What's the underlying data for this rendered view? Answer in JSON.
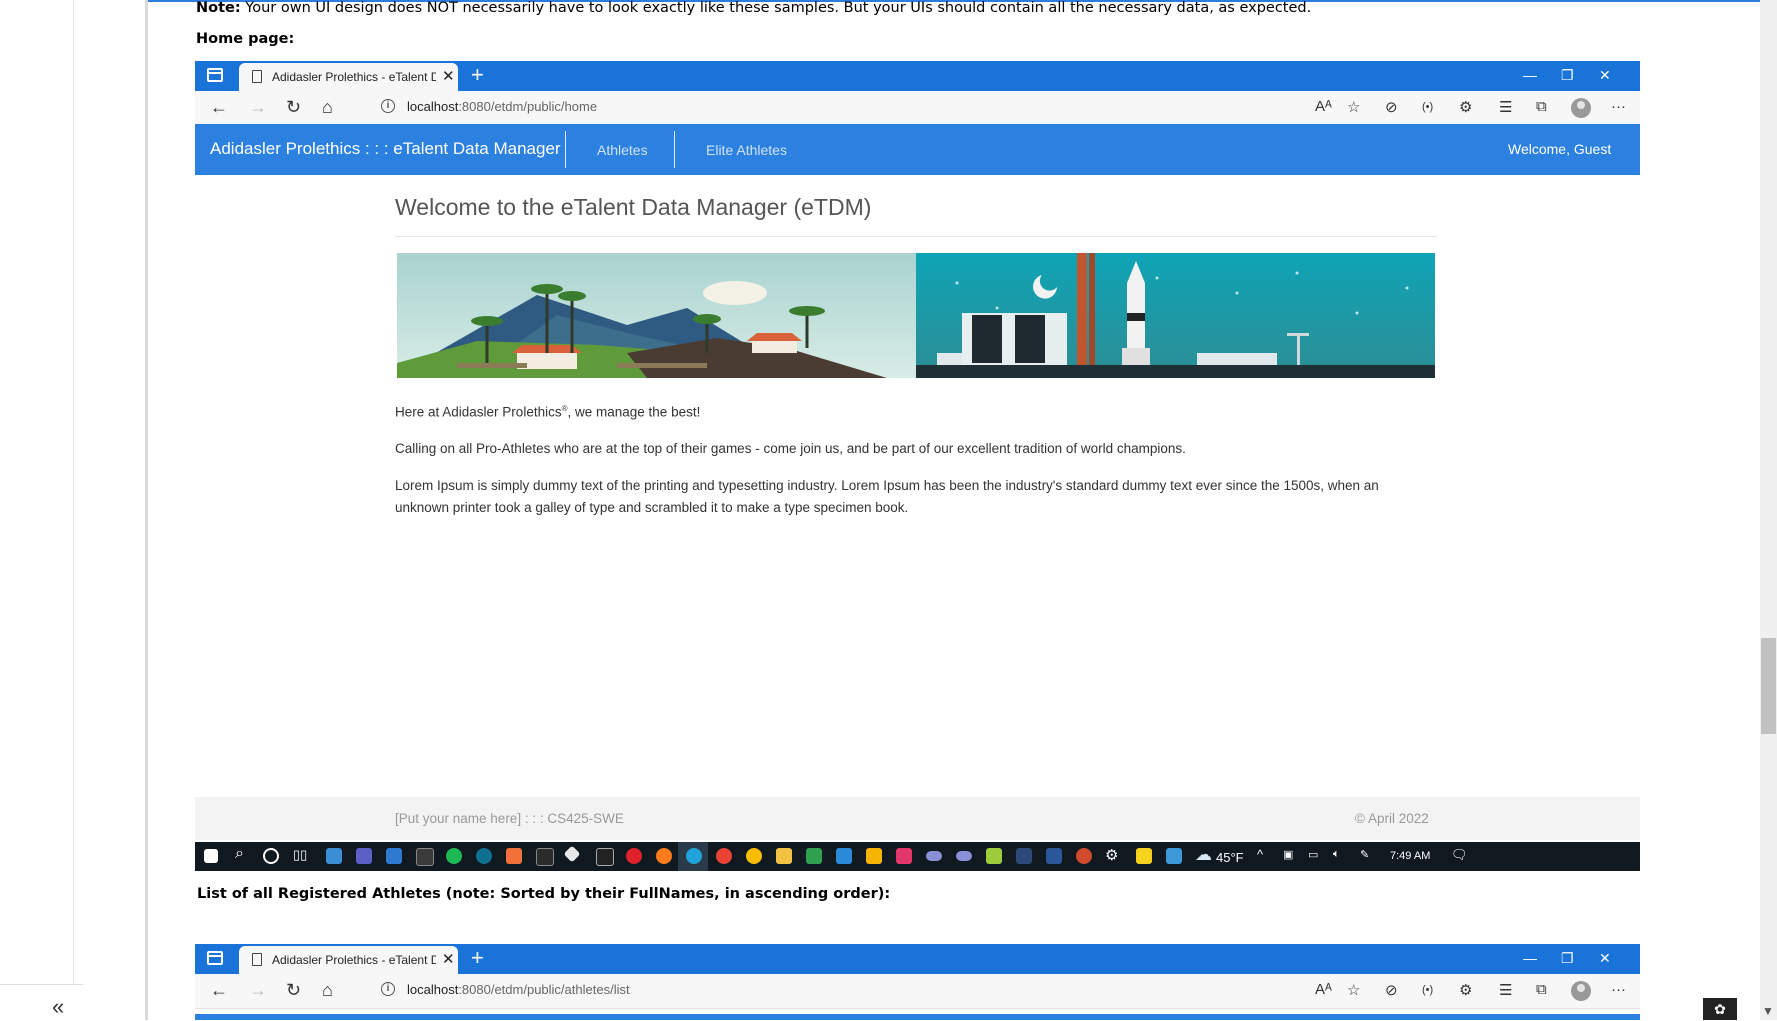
{
  "document": {
    "note_label": "Note:",
    "note_text": "Your own UI design does NOT necessarily have to look exactly like these samples. But your UIs should contain all the necessary data, as expected.",
    "home_page_label": "Home page:",
    "list_label": "List of all Registered Athletes (note: Sorted by their FullNames, in ascending order):"
  },
  "browser1": {
    "tab_title": "Adidasler Prolethics - eTalent Da",
    "url_host": "localhost",
    "url_rest": ":8080/etdm/public/home"
  },
  "browser2": {
    "tab_title": "Adidasler Prolethics - eTalent Da",
    "url_host": "localhost",
    "url_rest": ":8080/etdm/public/athletes/list"
  },
  "app": {
    "brand": "Adidasler Prolethics : : : eTalent Data Manager",
    "nav_athletes": "Athletes",
    "nav_elite": "Elite Athletes",
    "welcome": "Welcome, Guest",
    "heading": "Welcome to the eTalent Data Manager (eTDM)",
    "para1_pre": "Here at Adidasler Prolethics",
    "para1_sup": "®",
    "para1_post": ", we manage the best!",
    "para2": "Calling on all Pro-Athletes who are at the top of their games - come join us, and be part of our excellent tradition of world champions.",
    "para3_line1": "Lorem Ipsum is simply dummy text of the printing and typesetting industry. Lorem Ipsum has been the industry's standard dummy text ever since the 1500s, when an",
    "para3_line2": "unknown printer took a galley of type and scrambled it to make a type specimen book.",
    "footer_left": "[Put your name here] : : : CS425-SWE",
    "footer_right": "© April 2022"
  },
  "taskbar": {
    "weather": "45°F",
    "time": "7:49 AM"
  },
  "colors": {
    "browser_blue": "#1a73d9",
    "app_nav_blue": "#2b80e0",
    "taskbar": "#101820"
  }
}
